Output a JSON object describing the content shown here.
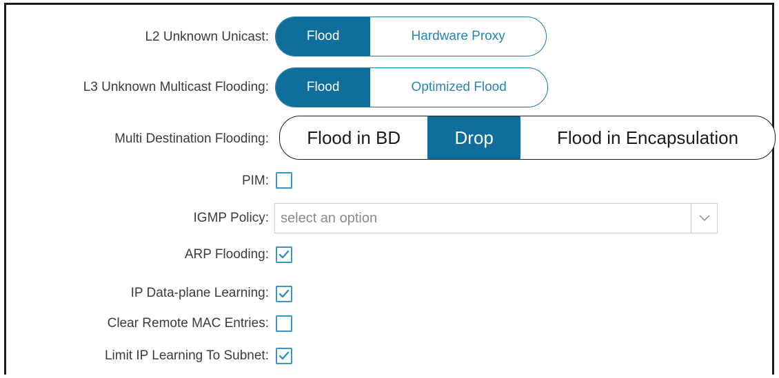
{
  "form": {
    "l2_unknown_unicast": {
      "label": "L2 Unknown Unicast:",
      "options": [
        "Flood",
        "Hardware Proxy"
      ],
      "selected": "Flood"
    },
    "l3_unknown_multicast": {
      "label": "L3 Unknown Multicast Flooding:",
      "options": [
        "Flood",
        "Optimized Flood"
      ],
      "selected": "Flood"
    },
    "multi_destination": {
      "label": "Multi Destination Flooding:",
      "options": [
        "Flood in BD",
        "Drop",
        "Flood in Encapsulation"
      ],
      "selected": "Drop"
    },
    "pim": {
      "label": "PIM:",
      "checked": false
    },
    "igmp_policy": {
      "label": "IGMP Policy:",
      "placeholder": "select an option"
    },
    "arp_flooding": {
      "label": "ARP Flooding:",
      "checked": true
    },
    "ip_dataplane_learning": {
      "label": "IP Data-plane Learning:",
      "checked": true
    },
    "clear_remote_mac": {
      "label": "Clear Remote MAC Entries:",
      "checked": false
    },
    "limit_ip_learning": {
      "label": "Limit IP Learning To Subnet:",
      "checked": true
    }
  },
  "colors": {
    "accent": "#0f6e9c",
    "accent_text": "#2786b3",
    "checkbox_border": "#3a96c6",
    "label_text": "#3b3b3b"
  }
}
